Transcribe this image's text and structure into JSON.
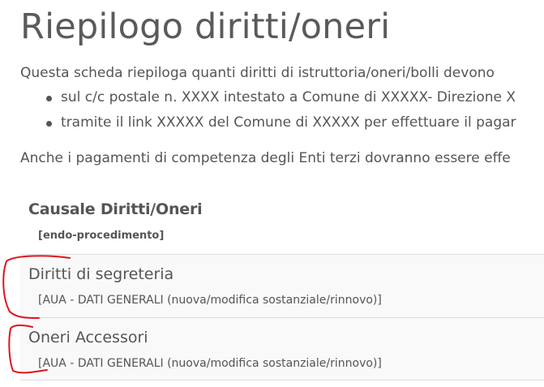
{
  "page": {
    "title": "Riepilogo diritti/oneri",
    "intro": "Questa scheda riepiloga quanti diritti di istruttoria/oneri/bolli devono",
    "bullets": [
      "sul c/c postale n. XXXX intestato a Comune di XXXXX- Direzione X",
      "tramite il link XXXXX del Comune di XXXXX per effettuare il pagar"
    ],
    "note": "Anche i pagamenti di competenza degli Enti terzi dovranno essere effe"
  },
  "table": {
    "header": {
      "main": "Causale Diritti/Oneri",
      "sub": "[endo-procedimento]"
    },
    "rows": [
      {
        "main": "Diritti di segreteria",
        "sub": "[AUA - DATI GENERALI (nuova/modifica sostanziale/rinnovo)]"
      },
      {
        "main": "Oneri Accessori",
        "sub": "[AUA - DATI GENERALI (nuova/modifica sostanziale/rinnovo)]"
      }
    ]
  },
  "colors": {
    "text": "#555555",
    "row_background": "#f9f9f9",
    "border": "#dddddd",
    "annotation": "#e0141e"
  }
}
